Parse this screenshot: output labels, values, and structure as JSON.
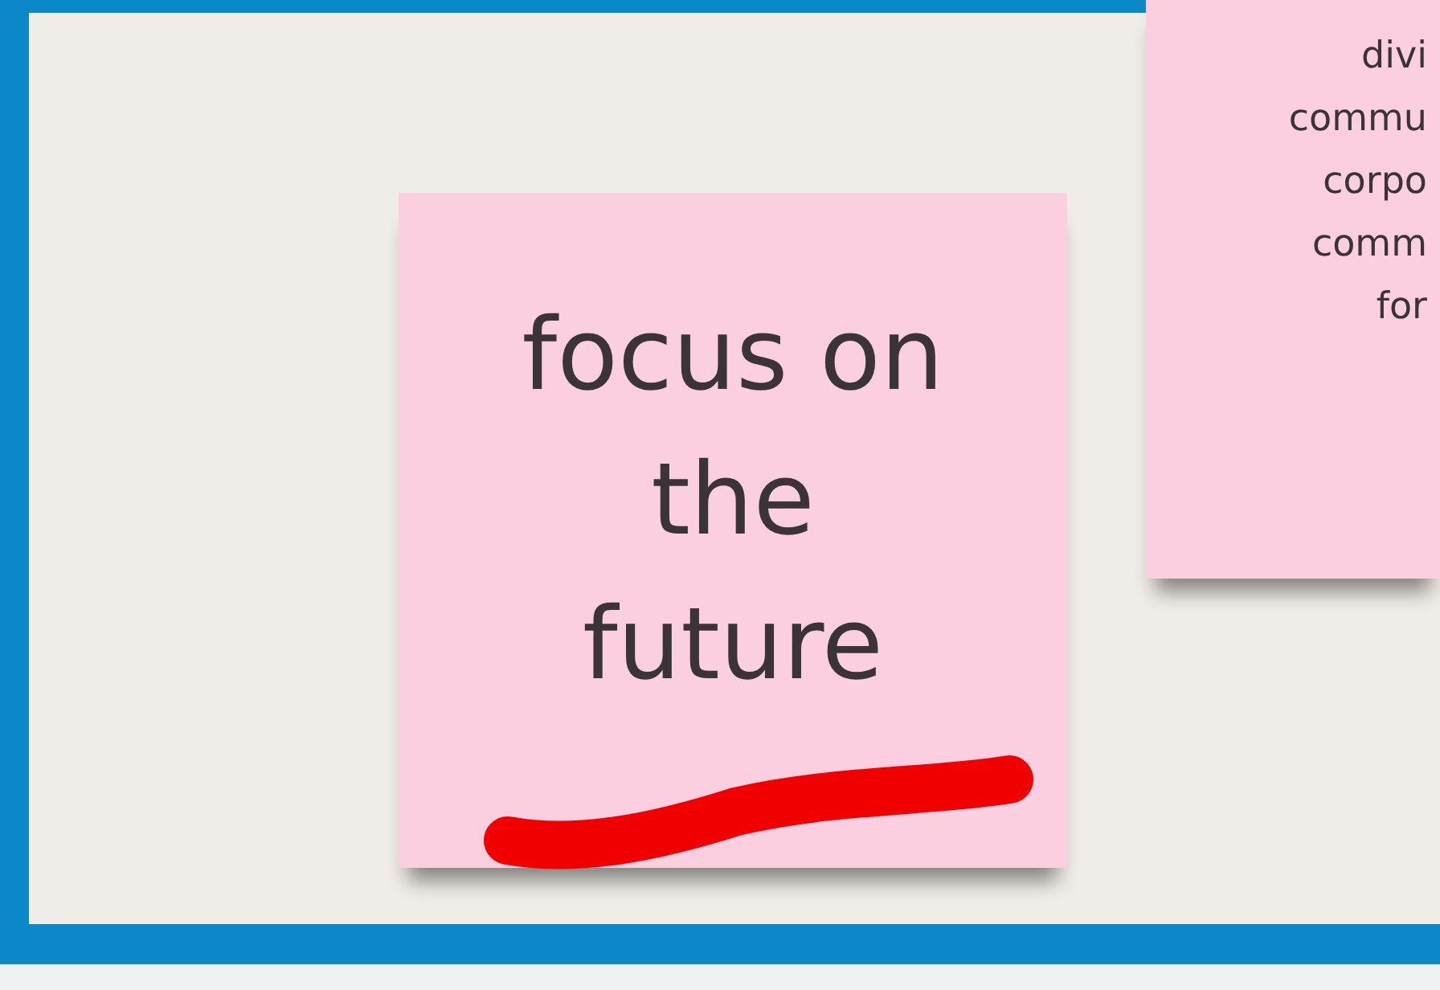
{
  "notes": [
    {
      "lines": [
        "focus on",
        "the",
        "future"
      ],
      "underlined": true
    },
    {
      "lines": [
        "divi",
        "commu",
        "corpo",
        "comm",
        "for"
      ],
      "underlined": false
    }
  ]
}
